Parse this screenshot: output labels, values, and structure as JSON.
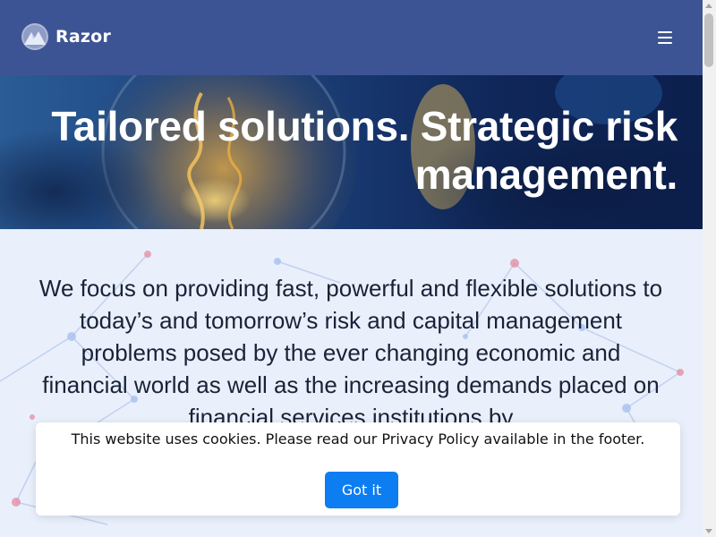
{
  "header": {
    "brand": "Razor",
    "logo_icon": "mountain-logo-icon",
    "menu_icon": "hamburger-menu-icon"
  },
  "hero": {
    "title": "Tailored solutions. Strategic risk management."
  },
  "intro": {
    "text": "We focus on providing fast, powerful and flexible solutions to today’s and tomorrow’s risk and capital management problems posed by the ever changing economic and financial world as well as the increasing demands placed on financial services institutions by"
  },
  "cookie_banner": {
    "message": "This website uses cookies. Please read our Privacy Policy available in the footer.",
    "accept_label": "Got it"
  },
  "colors": {
    "header_bg": "#3d5494",
    "accent_button": "#0d7df2",
    "intro_bg": "#e9f0fb",
    "text_dark": "#1a2238"
  }
}
